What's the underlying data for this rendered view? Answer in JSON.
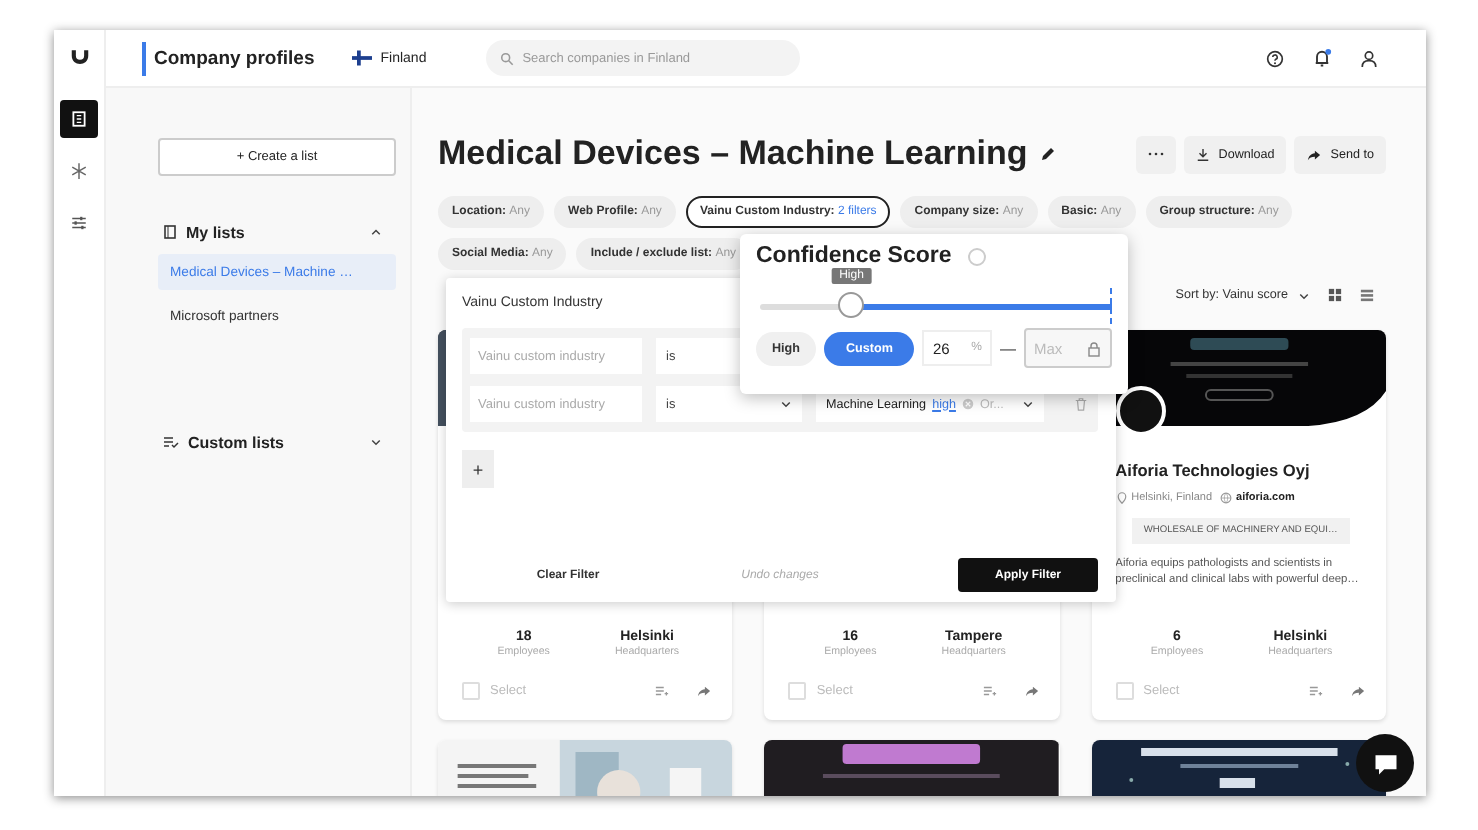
{
  "rail": [
    {
      "selected": true
    },
    {
      "selected": false
    },
    {
      "selected": false
    }
  ],
  "top_bar": {
    "title": "Company profiles",
    "country": "Finland",
    "search": {
      "placeholder": "Search companies in Finland"
    },
    "notifications_unread": true
  },
  "sidebar": {
    "create_button": "+ Create a list",
    "sections": [
      {
        "title": "My lists",
        "expanded": true,
        "items": [
          {
            "label": "Medical Devices – Machine …",
            "selected": true
          },
          {
            "label": "Microsoft partners",
            "selected": false
          }
        ]
      },
      {
        "title": "Custom lists",
        "expanded": false
      }
    ]
  },
  "page": {
    "title": "Medical Devices – Machine Learning",
    "actions": [
      {
        "kind": "more"
      },
      {
        "kind": "download",
        "label": "Download"
      },
      {
        "kind": "send",
        "label": "Send to"
      }
    ]
  },
  "filters": [
    [
      {
        "label": "Location:",
        "value": "Any",
        "active": false
      },
      {
        "label": "Web Profile:",
        "value": "Any",
        "active": false
      },
      {
        "label": "Vainu Custom Industry:",
        "value": "2 filters",
        "active": true
      },
      {
        "label": "Company size:",
        "value": "Any",
        "active": false
      },
      {
        "label": "Basic:",
        "value": "Any",
        "active": false
      },
      {
        "label": "Group structure:",
        "value": "Any",
        "active": false
      }
    ],
    [
      {
        "label": "Social Media:",
        "value": "Any",
        "active": false
      },
      {
        "label": "Include / exclude list:",
        "value": "Any",
        "active": false
      }
    ]
  ],
  "sort": {
    "label": "Sort by: Vainu score"
  },
  "cards": [
    {
      "kind": "profile",
      "stats": [
        {
          "value": "18",
          "label": "Employees"
        },
        {
          "value": "Helsinki",
          "label": "Headquarters"
        }
      ],
      "select": {
        "label": "Select",
        "checked": false
      }
    },
    {
      "kind": "profile",
      "stats": [
        {
          "value": "16",
          "label": "Employees"
        },
        {
          "value": "Tampere",
          "label": "Headquarters"
        }
      ],
      "select": {
        "label": "Select",
        "checked": false
      }
    },
    {
      "kind": "profile",
      "name": "Aiforia Technologies Oyj",
      "location": "Helsinki, Finland",
      "website": "aiforia.com",
      "tag": "WHOLESALE OF MACHINERY AND EQUI…",
      "description": "Aiforia equips pathologists and scientists in preclinical and clinical labs with powerful deep…",
      "stats": [
        {
          "value": "6",
          "label": "Employees"
        },
        {
          "value": "Helsinki",
          "label": "Headquarters"
        }
      ],
      "select": {
        "label": "Select",
        "checked": false
      }
    },
    {
      "kind": "picture"
    },
    {
      "kind": "picture"
    },
    {
      "kind": "picture"
    }
  ],
  "filter_panel": {
    "title": "Vainu Custom Industry",
    "rows": [
      {
        "field_placeholder": "Vainu custom industry",
        "operator": "is"
      },
      {
        "field_placeholder": "Vainu custom industry",
        "operator": "is",
        "value": {
          "text": "Machine Learning",
          "confidence": "high",
          "placeholder": "Or..."
        }
      }
    ],
    "add_button": "+",
    "clear_button": "Clear Filter",
    "undo_button": "Undo changes",
    "apply_button": "Apply Filter"
  },
  "confidence_popup": {
    "title": "Confidence Score",
    "tooltip": "High",
    "level": 0.26,
    "presets": [
      {
        "label": "High",
        "selected": false
      },
      {
        "label": "Custom",
        "selected": true
      }
    ],
    "min_value": "26",
    "unit": "%",
    "separator": "—",
    "max_placeholder": "Max",
    "max_locked": true
  }
}
